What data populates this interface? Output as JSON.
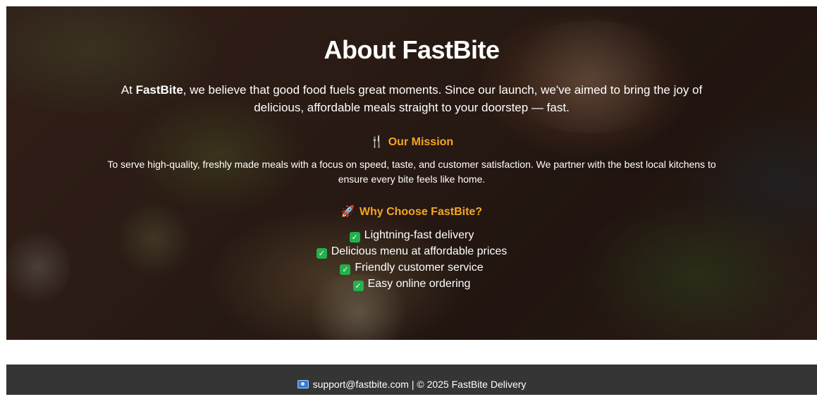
{
  "hero": {
    "title": "About FastBite",
    "intro_prefix": "At ",
    "intro_brand": "FastBite",
    "intro_rest": ", we believe that good food fuels great moments. Since our launch, we've aimed to bring the joy of delicious, affordable meals straight to your doorstep — fast.",
    "mission_icon": "🍴",
    "mission_heading": "Our Mission",
    "mission_text": "To serve high-quality, freshly made meals with a focus on speed, taste, and customer satisfaction. We partner with the best local kitchens to ensure every bite feels like home.",
    "why_icon": "🚀",
    "why_heading": "Why Choose FastBite?",
    "features": [
      "Lightning-fast delivery",
      "Delicious menu at affordable prices",
      "Friendly customer service",
      "Easy online ordering"
    ]
  },
  "footer": {
    "email_link": "support@fastbite.com",
    "copyright": " | © 2025 FastBite Delivery"
  },
  "colors": {
    "accent": "#f5a623",
    "check": "#22b14c",
    "footer_bg": "#353535"
  },
  "icons": {
    "mission": "fork-knife-icon",
    "why": "rocket-icon",
    "feature": "check-box-icon",
    "footer": "mail-icon"
  }
}
